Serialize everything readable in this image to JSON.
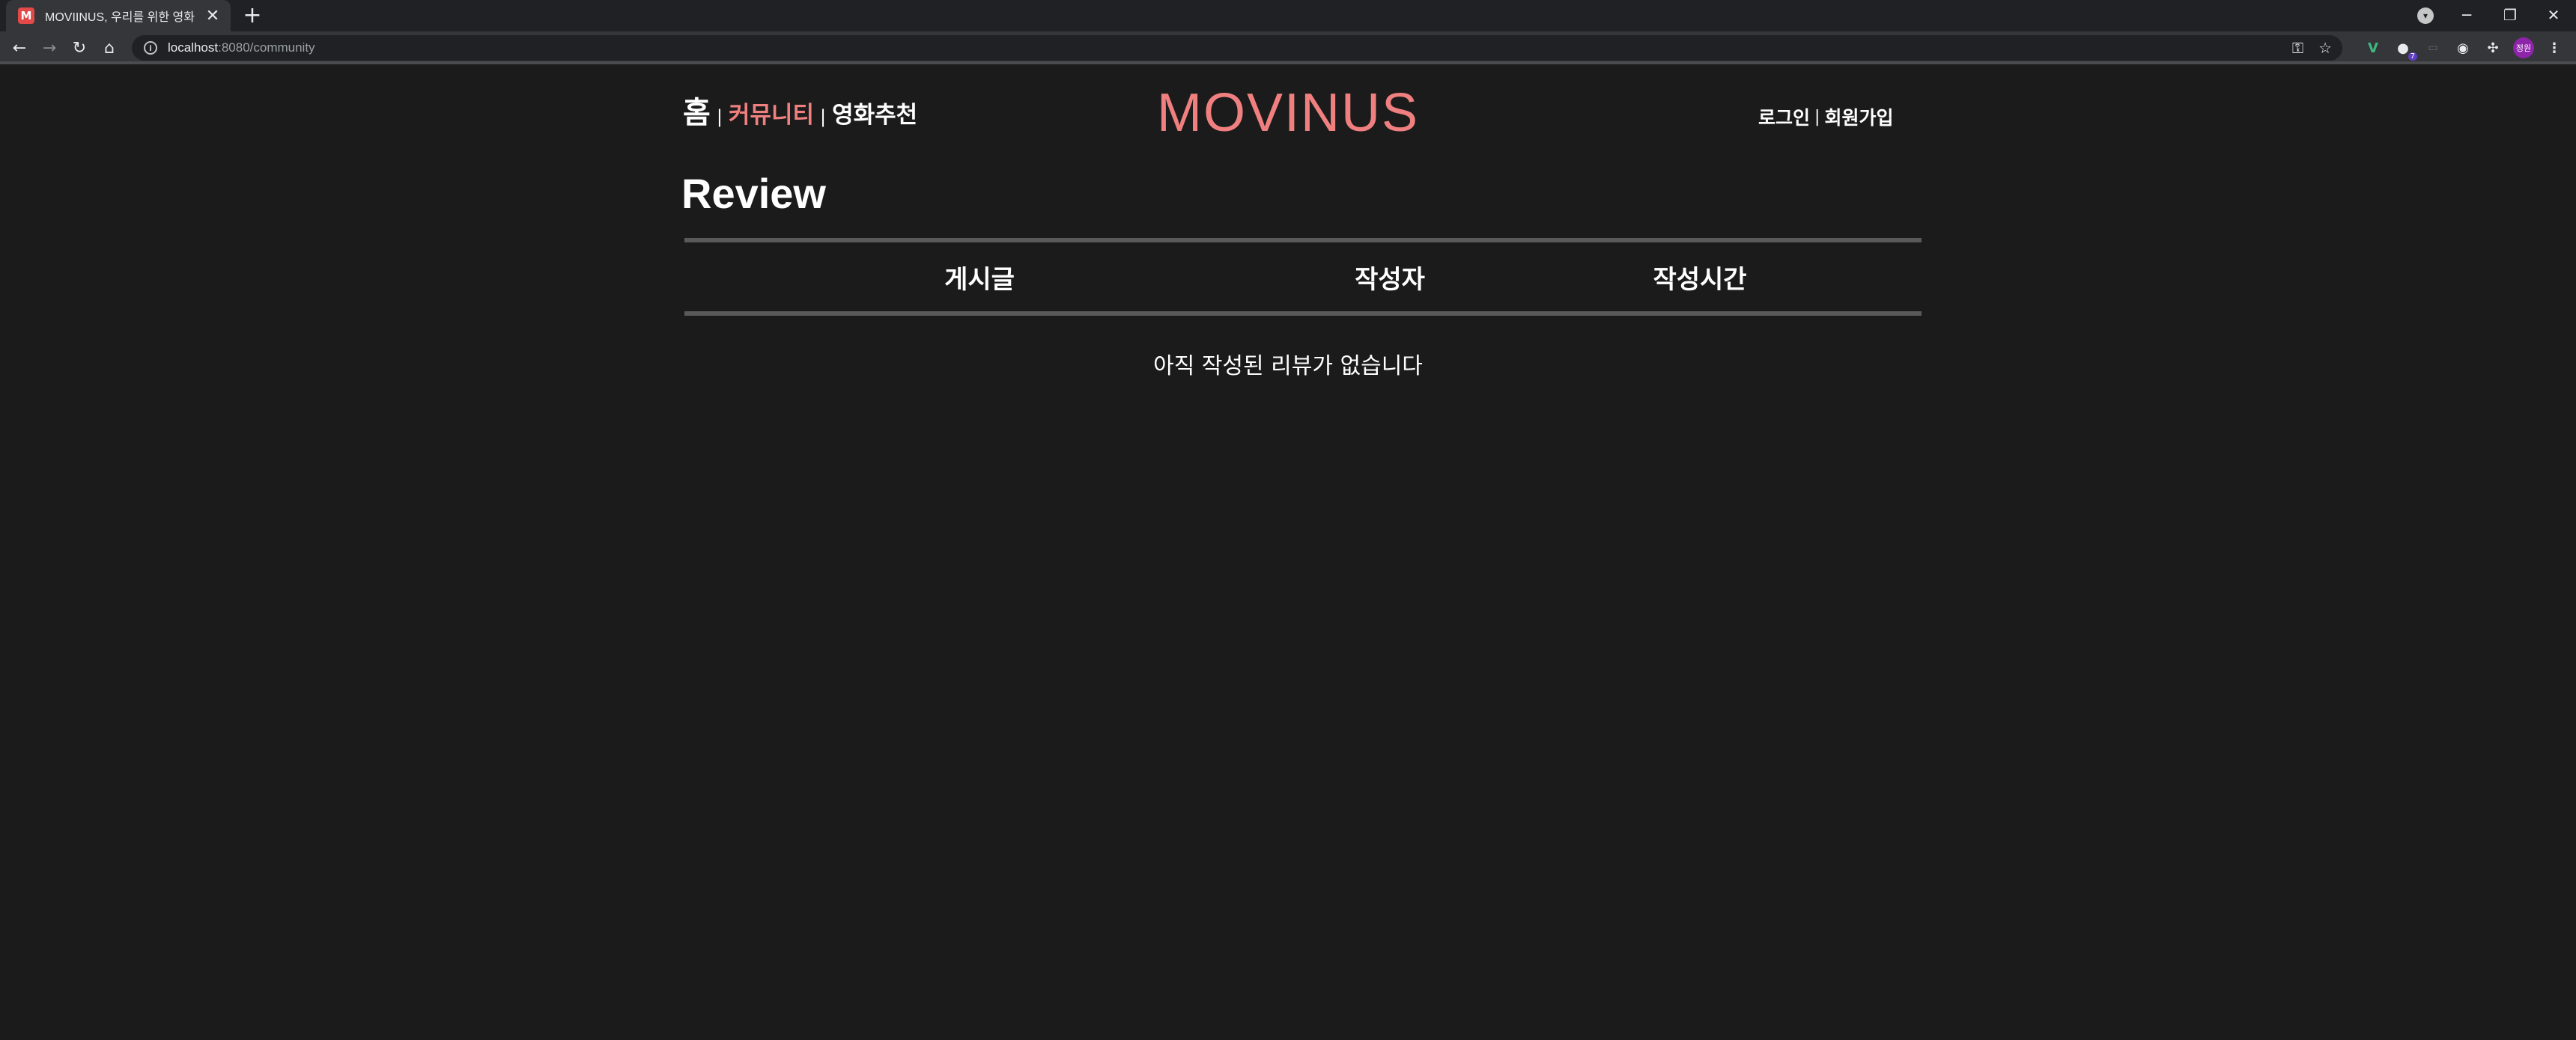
{
  "browser": {
    "tab": {
      "favicon": "M",
      "title": "MOVIINUS, 우리를 위한 영화",
      "close_glyph": "✕"
    },
    "new_tab_glyph": "+",
    "address": {
      "host": "localhost",
      "path": ":8080/community"
    },
    "window_controls": {
      "minimize": "─",
      "restore": "❐",
      "close": "✕"
    },
    "profile_initials": "정원",
    "extension_badge": "7",
    "icons": [
      "back-arrow-icon",
      "forward-arrow-icon",
      "reload-icon",
      "home-icon",
      "info-icon",
      "key-icon",
      "star-icon",
      "vue-devtools-icon",
      "extension-icon",
      "puzzle-icon",
      "kebab-menu-icon"
    ]
  },
  "nav": {
    "home": "홈",
    "separator": "|",
    "community": "커뮤니티",
    "recommend": "영화추천",
    "login": "로그인",
    "signup": "회원가입"
  },
  "logo": "MOVINUS",
  "page": {
    "title": "Review",
    "table": {
      "columns": [
        "게시글",
        "작성자",
        "작성시간"
      ]
    },
    "empty_message": "아직 작성된 리뷰가 없습니다"
  },
  "colors": {
    "background": "#1b1b1b",
    "accent": "#f08080",
    "rule": "#5a5a5a"
  }
}
